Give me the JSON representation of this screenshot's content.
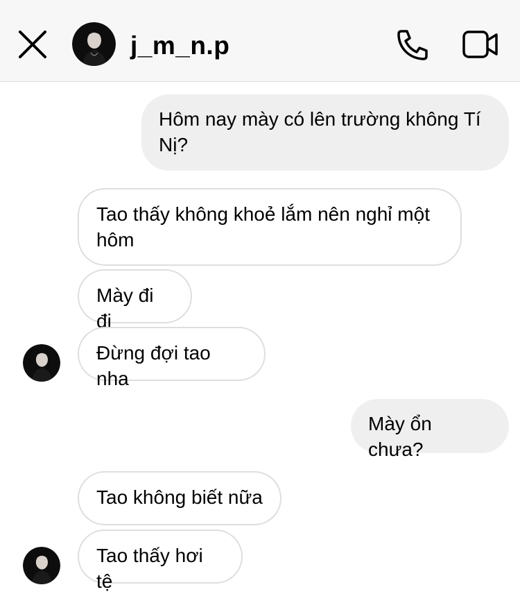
{
  "header": {
    "username": "j_m_n.p",
    "close_icon": "close-icon",
    "call_icon": "phone-icon",
    "video_icon": "video-camera-icon"
  },
  "messages": [
    {
      "direction": "outgoing",
      "text": "Hôm nay mày có lên trường không Tí Nị?"
    },
    {
      "direction": "incoming",
      "text": "Tao thấy không khoẻ lắm nên nghỉ một hôm"
    },
    {
      "direction": "incoming",
      "text": "Mày đi đi"
    },
    {
      "direction": "incoming",
      "text": "Đừng đợi tao nha"
    },
    {
      "direction": "outgoing",
      "text": "Mày ổn chưa?"
    },
    {
      "direction": "incoming",
      "text": "Tao không biết nữa"
    },
    {
      "direction": "incoming",
      "text": "Tao thấy hơi tệ"
    }
  ],
  "colors": {
    "outgoing_bubble": "#efefef",
    "incoming_bubble": "#ffffff",
    "incoming_border": "#dedede",
    "header_background": "#f7f7f7"
  }
}
